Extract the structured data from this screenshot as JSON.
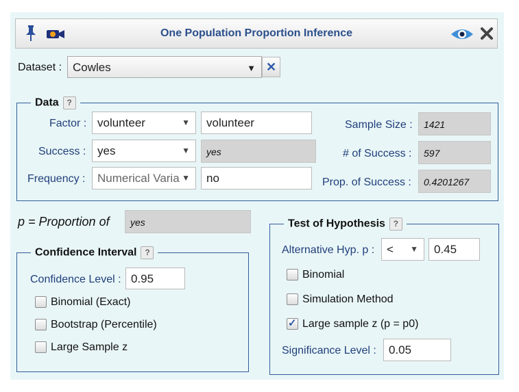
{
  "window": {
    "title": "One Population Proportion Inference",
    "icons": [
      "pin-icon",
      "camera-icon",
      "eye-icon",
      "close-icon"
    ]
  },
  "dataset": {
    "label": "Dataset :",
    "value": "Cowles",
    "clear_icon": "✕"
  },
  "data_section": {
    "legend": "Data",
    "help": "?",
    "factor_label": "Factor :",
    "factor_select": "volunteer",
    "factor_text": "volunteer",
    "success_label": "Success :",
    "success_select": "yes",
    "success_value": "yes",
    "frequency_label": "Frequency :",
    "frequency_select": "Numerical Varia",
    "frequency_text": "no",
    "sample_size_label": "Sample Size :",
    "sample_size_value": "1421",
    "num_success_label": "# of Success :",
    "num_success_value": "597",
    "prop_success_label": "Prop. of Success :",
    "prop_success_value": "0.4201267"
  },
  "proportion": {
    "label": "p = Proportion of",
    "value": "yes"
  },
  "confidence_interval": {
    "legend": "Confidence Interval",
    "help": "?",
    "level_label": "Confidence Level :",
    "level_value": "0.95",
    "options": [
      {
        "label": "Binomial (Exact)",
        "checked": false
      },
      {
        "label": "Bootstrap (Percentile)",
        "checked": false
      },
      {
        "label": "Large Sample z",
        "checked": false
      }
    ]
  },
  "hypothesis_test": {
    "legend": "Test of Hypothesis",
    "help": "?",
    "alt_label": "Alternative Hyp. p :",
    "alt_select": "<",
    "alt_value": "0.45",
    "options": [
      {
        "label": "Binomial",
        "checked": false
      },
      {
        "label": "Simulation Method",
        "checked": false
      },
      {
        "label": "Large sample z (p = p0)",
        "checked": true
      }
    ],
    "sig_label": "Significance Level :",
    "sig_value": "0.05"
  },
  "colors": {
    "panel_bg": "#e9f6f7",
    "title_text": "#2b4f8c",
    "label_text": "#1f3f7a",
    "border": "#2f5c9a"
  }
}
